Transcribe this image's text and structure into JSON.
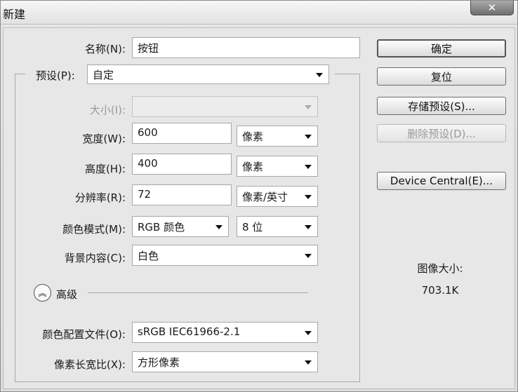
{
  "window": {
    "title": "新建",
    "close_glyph": "✕"
  },
  "form": {
    "name_label": "名称(N):",
    "name_value": "按钮",
    "preset_label": "预设(P):",
    "preset_value": "自定",
    "size_label": "大小(I):",
    "size_value": "",
    "width_label": "宽度(W):",
    "width_value": "600",
    "width_unit": "像素",
    "height_label": "高度(H):",
    "height_value": "400",
    "height_unit": "像素",
    "resolution_label": "分辨率(R):",
    "resolution_value": "72",
    "resolution_unit": "像素/英寸",
    "color_mode_label": "颜色模式(M):",
    "color_mode_value": "RGB 颜色",
    "bit_depth_value": "8 位",
    "background_label": "背景内容(C):",
    "background_value": "白色"
  },
  "advanced": {
    "toggle_glyph": "︽",
    "label": "高级",
    "color_profile_label": "颜色配置文件(O):",
    "color_profile_value": "sRGB IEC61966-2.1",
    "pixel_aspect_label": "像素长宽比(X):",
    "pixel_aspect_value": "方形像素"
  },
  "buttons": {
    "ok": "确定",
    "reset": "复位",
    "save_preset": "存储预设(S)...",
    "delete_preset": "删除预设(D)...",
    "device_central": "Device Central(E)..."
  },
  "image_size": {
    "label": "图像大小:",
    "value": "703.1K"
  }
}
